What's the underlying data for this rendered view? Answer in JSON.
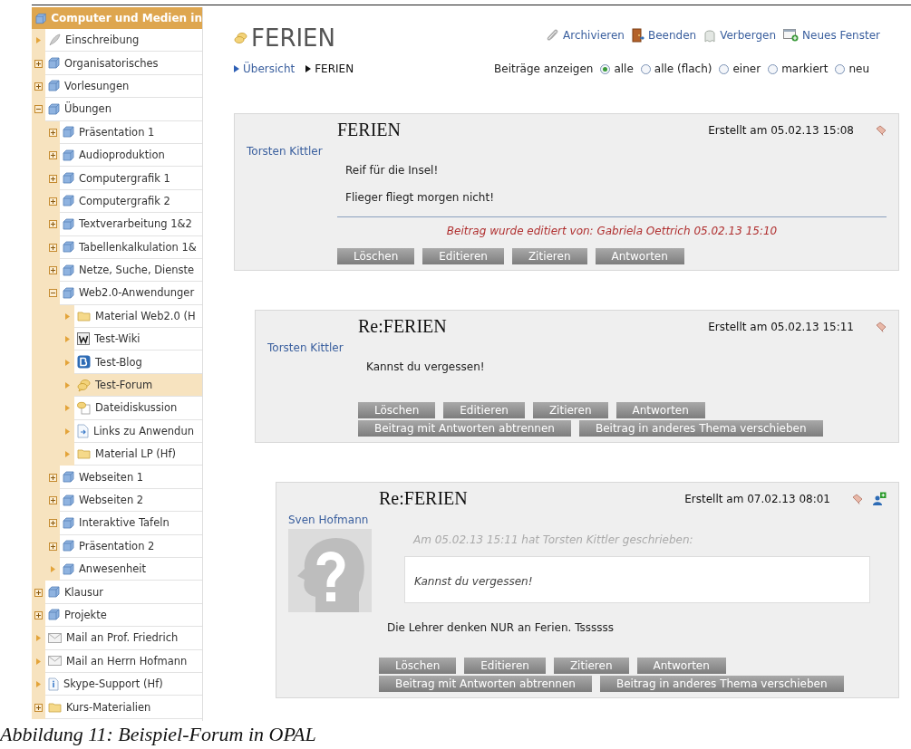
{
  "sidebar": {
    "title": "Computer und Medien in",
    "items": [
      {
        "label": "Einschreibung",
        "kind": "enrollment",
        "expandable": false,
        "selected": false
      },
      {
        "label": "Organisatorisches",
        "kind": "node",
        "expandable": true,
        "expanded": false,
        "selected": false
      },
      {
        "label": "Vorlesungen",
        "kind": "node",
        "expandable": true,
        "expanded": false,
        "selected": false
      },
      {
        "label": "Übungen",
        "kind": "node",
        "expandable": true,
        "expanded": true,
        "selected": false,
        "children": [
          {
            "label": "Präsentation 1",
            "kind": "node",
            "expandable": true,
            "expanded": false,
            "selected": false
          },
          {
            "label": "Audioproduktion",
            "kind": "node",
            "expandable": true,
            "expanded": false,
            "selected": false
          },
          {
            "label": "Computergrafik 1",
            "kind": "node",
            "expandable": true,
            "expanded": false,
            "selected": false
          },
          {
            "label": "Computergrafik 2",
            "kind": "node",
            "expandable": true,
            "expanded": false,
            "selected": false
          },
          {
            "label": "Textverarbeitung 1&2",
            "kind": "node",
            "expandable": true,
            "expanded": false,
            "selected": false
          },
          {
            "label": "Tabellenkalkulation 1&",
            "kind": "node",
            "expandable": true,
            "expanded": false,
            "selected": false
          },
          {
            "label": "Netze, Suche, Dienste",
            "kind": "node",
            "expandable": true,
            "expanded": false,
            "selected": false
          },
          {
            "label": "Web2.0-Anwendunger",
            "kind": "node",
            "expandable": true,
            "expanded": true,
            "selected": false,
            "children": [
              {
                "label": "Material Web2.0 (H",
                "kind": "folder",
                "expandable": false,
                "selected": false
              },
              {
                "label": "Test-Wiki",
                "kind": "wiki",
                "expandable": false,
                "selected": false
              },
              {
                "label": "Test-Blog",
                "kind": "blog",
                "expandable": false,
                "selected": false
              },
              {
                "label": "Test-Forum",
                "kind": "forum",
                "expandable": false,
                "selected": true
              },
              {
                "label": "Dateidiskussion",
                "kind": "discussion",
                "expandable": false,
                "selected": false
              },
              {
                "label": "Links zu Anwendun",
                "kind": "link",
                "expandable": false,
                "selected": false
              },
              {
                "label": "Material LP (Hf)",
                "kind": "folder",
                "expandable": false,
                "selected": false
              }
            ]
          },
          {
            "label": "Webseiten 1",
            "kind": "node",
            "expandable": true,
            "expanded": false,
            "selected": false
          },
          {
            "label": "Webseiten 2",
            "kind": "node",
            "expandable": true,
            "expanded": false,
            "selected": false
          },
          {
            "label": "Interaktive Tafeln",
            "kind": "node",
            "expandable": true,
            "expanded": false,
            "selected": false
          },
          {
            "label": "Präsentation 2",
            "kind": "node",
            "expandable": true,
            "expanded": false,
            "selected": false
          },
          {
            "label": "Anwesenheit",
            "kind": "node",
            "expandable": false,
            "selected": false
          }
        ]
      },
      {
        "label": "Klausur",
        "kind": "node",
        "expandable": true,
        "expanded": false,
        "selected": false
      },
      {
        "label": "Projekte",
        "kind": "node",
        "expandable": true,
        "expanded": false,
        "selected": false
      },
      {
        "label": "Mail an Prof. Friedrich",
        "kind": "mail",
        "expandable": false,
        "selected": false
      },
      {
        "label": "Mail an Herrn Hofmann",
        "kind": "mail",
        "expandable": false,
        "selected": false
      },
      {
        "label": "Skype-Support (Hf)",
        "kind": "info",
        "expandable": false,
        "selected": false
      },
      {
        "label": "Kurs-Materialien",
        "kind": "folder",
        "expandable": true,
        "expanded": false,
        "selected": false
      }
    ]
  },
  "page": {
    "title": "FERIEN",
    "actions": [
      {
        "kind": "archive",
        "label": "Archivieren"
      },
      {
        "kind": "exit",
        "label": "Beenden"
      },
      {
        "kind": "hide",
        "label": "Verbergen"
      },
      {
        "kind": "new-window",
        "label": "Neues Fenster"
      }
    ],
    "breadcrumb": [
      {
        "label": "Übersicht",
        "selected": false
      },
      {
        "label": "FERIEN",
        "selected": true
      }
    ],
    "view_filter": {
      "label": "Beiträge anzeigen",
      "options": [
        {
          "label": "alle",
          "selected": true
        },
        {
          "label": "alle (flach)",
          "selected": false
        },
        {
          "label": "einer",
          "selected": false
        },
        {
          "label": "markiert",
          "selected": false
        },
        {
          "label": "neu",
          "selected": false
        }
      ]
    }
  },
  "posts": [
    {
      "title": "FERIEN",
      "date": "Erstellt am 05.02.13 15:08",
      "icons": [
        {
          "kind": "tag"
        }
      ],
      "author": "Torsten Kittler",
      "avatar": false,
      "body": [
        "Reif für die Insel!",
        "Flieger fliegt morgen nicht!"
      ],
      "edit_note": "Beitrag wurde editiert von: Gabriela Oettrich 05.02.13 15:10",
      "buttons": [
        [
          "Löschen",
          "Editieren",
          "Zitieren",
          "Antworten"
        ]
      ],
      "children": [
        {
          "title": "Re:FERIEN",
          "date": "Erstellt am 05.02.13 15:11",
          "icons": [
            {
              "kind": "tag"
            }
          ],
          "author": "Torsten Kittler",
          "avatar": false,
          "body": [
            "Kannst du vergessen!"
          ],
          "buttons": [
            [
              "Löschen",
              "Editieren",
              "Zitieren",
              "Antworten"
            ],
            [
              "Beitrag mit Antworten abtrennen",
              "Beitrag in anderes Thema verschieben"
            ]
          ],
          "children": [
            {
              "title": "Re:FERIEN",
              "date": "Erstellt am 07.02.13 08:01",
              "icons": [
                {
                  "kind": "tag"
                },
                {
                  "kind": "add-user"
                }
              ],
              "author": "Sven Hofmann",
              "avatar": true,
              "quote": {
                "header": "Am 05.02.13 15:11 hat Torsten Kittler geschrieben:",
                "text": "Kannst du vergessen!"
              },
              "body": [
                "Die Lehrer denken NUR an Ferien. Tssssss"
              ],
              "buttons": [
                [
                  "Löschen",
                  "Editieren",
                  "Zitieren",
                  "Antworten"
                ],
                [
                  "Beitrag mit Antworten abtrennen",
                  "Beitrag in anderes Thema verschieben"
                ]
              ]
            }
          ]
        }
      ]
    }
  ],
  "caption": "Abbildung 11: Beispiel-Forum in OPAL"
}
